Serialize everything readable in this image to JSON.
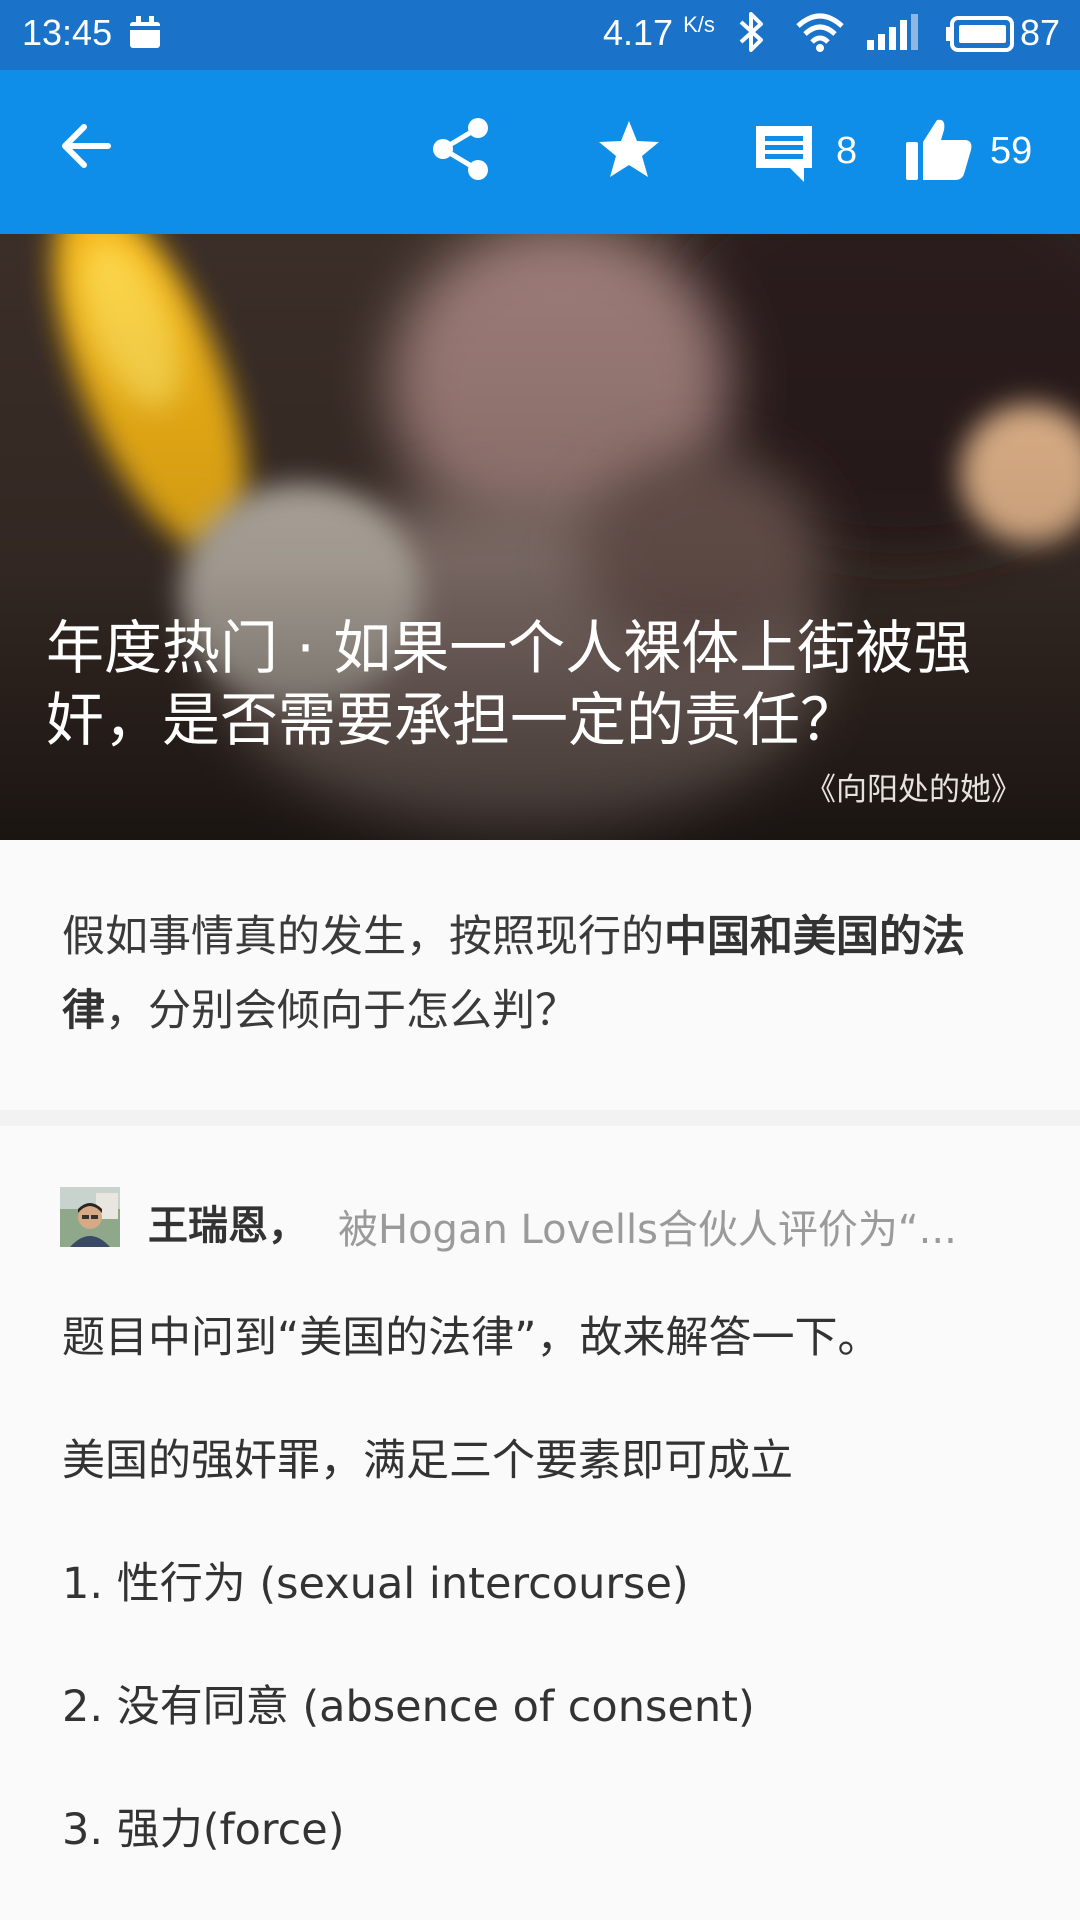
{
  "status_bar": {
    "time": "13:45",
    "net_speed": "4.17",
    "net_speed_unit": "K/s",
    "battery": "87",
    "icons": [
      "calendar-icon",
      "bluetooth-icon",
      "wifi-icon",
      "signal-icon",
      "battery-icon"
    ]
  },
  "toolbar": {
    "comment_count": "8",
    "like_count": "59",
    "icons": [
      "back-arrow-icon",
      "share-icon",
      "star-icon",
      "comment-icon",
      "thumbs-up-icon"
    ],
    "color": "#0e8ee9"
  },
  "article": {
    "title": "年度热门 · 如果一个人裸体上街被强奸，是否需要承担一定的责任？",
    "source": "《向阳处的她》",
    "question_part1": "假如事情真的发生，按照现行的",
    "question_bold": "中国和美国的法律",
    "question_part2": "，分别会倾向于怎么判？"
  },
  "answer": {
    "author_name": "王瑞恩，",
    "author_bio": "被Hogan Lovells合伙人评价为“...",
    "lines": [
      "题目中问到“美国的法律”，故来解答一下。",
      "美国的强奸罪，满足三个要素即可成立",
      "1. 性行为 (sexual intercourse)",
      "2. 没有同意 (absence of consent)",
      "3. 强力(force)"
    ]
  }
}
